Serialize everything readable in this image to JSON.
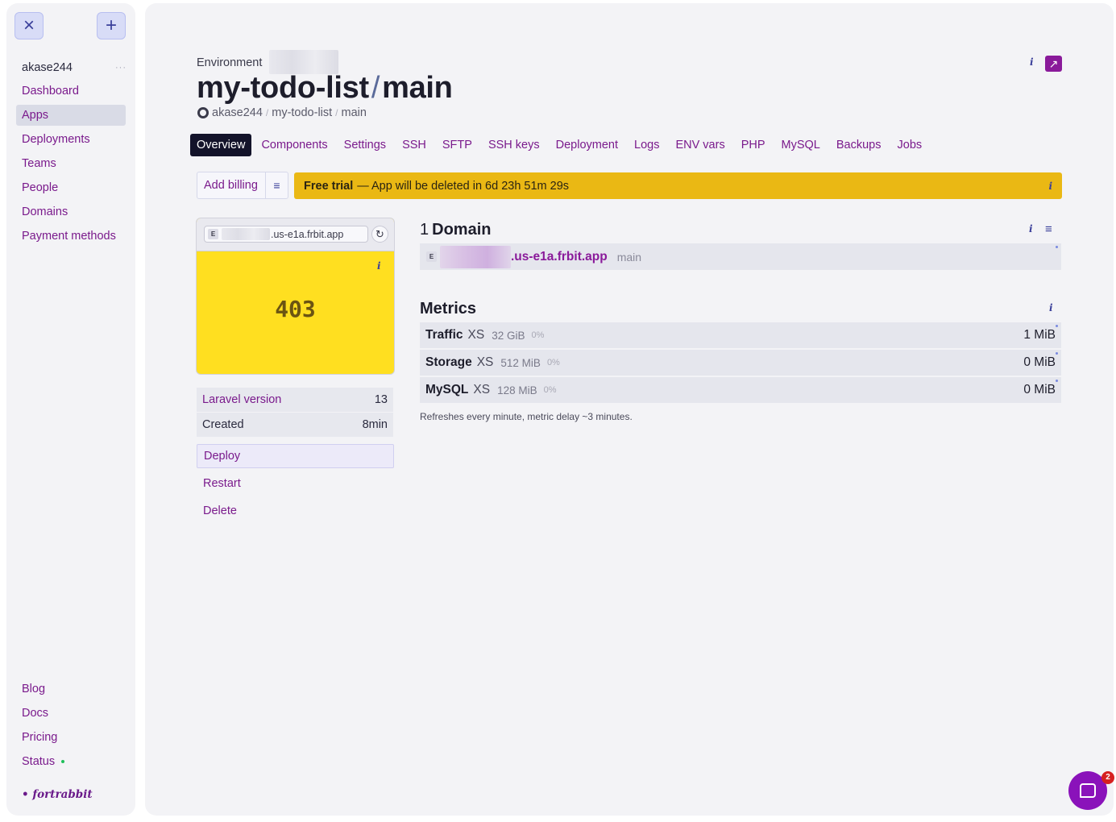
{
  "sidebar": {
    "close_icon": "×",
    "add_icon": "+",
    "user": "akase244",
    "user_more": "···",
    "items": [
      {
        "label": "Dashboard"
      },
      {
        "label": "Apps"
      },
      {
        "label": "Deployments"
      },
      {
        "label": "Teams"
      },
      {
        "label": "People"
      },
      {
        "label": "Domains"
      },
      {
        "label": "Payment methods"
      }
    ],
    "bottom_items": [
      {
        "label": "Blog"
      },
      {
        "label": "Docs"
      },
      {
        "label": "Pricing"
      },
      {
        "label": "Status"
      }
    ],
    "logo": "• fortrabbit"
  },
  "header": {
    "env_label": "Environment",
    "title_app": "my-todo-list",
    "title_sep": "/",
    "title_env": "main",
    "crumb_owner": "akase244",
    "crumb_sep": "/",
    "crumb_repo": "my-todo-list",
    "crumb_branch": "main",
    "info": "i",
    "external_icon": "↗"
  },
  "tabs": [
    {
      "label": "Overview"
    },
    {
      "label": "Components"
    },
    {
      "label": "Settings"
    },
    {
      "label": "SSH"
    },
    {
      "label": "SFTP"
    },
    {
      "label": "SSH keys"
    },
    {
      "label": "Deployment"
    },
    {
      "label": "Logs"
    },
    {
      "label": "ENV vars"
    },
    {
      "label": "PHP"
    },
    {
      "label": "MySQL"
    },
    {
      "label": "Backups"
    },
    {
      "label": "Jobs"
    }
  ],
  "billing": {
    "label": "Add billing",
    "menu_icon": "≡"
  },
  "trial": {
    "strong": "Free trial",
    "text": "— App will be deleted in 6d 23h 51m 29s",
    "info": "i"
  },
  "preview": {
    "badge": "E",
    "url_suffix": ".us-e1a.frbit.app",
    "reload_icon": "↻",
    "info": "i",
    "status_code": "403"
  },
  "details": {
    "rows": [
      {
        "key": "Laravel version",
        "value": "13"
      },
      {
        "key": "Created",
        "value": "8min"
      }
    ],
    "actions": [
      {
        "label": "Deploy"
      },
      {
        "label": "Restart"
      },
      {
        "label": "Delete"
      }
    ]
  },
  "domain": {
    "count": "1",
    "title": "Domain",
    "info": "i",
    "menu_icon": "≡",
    "badge": "E",
    "host_suffix": ".us-e1a.frbit.app",
    "branch": "main"
  },
  "metrics": {
    "title": "Metrics",
    "info": "i",
    "rows": [
      {
        "name": "Traffic",
        "tier": "XS",
        "limit": "32 GiB",
        "pct": "0%",
        "value": "1 MiB"
      },
      {
        "name": "Storage",
        "tier": "XS",
        "limit": "512 MiB",
        "pct": "0%",
        "value": "0 MiB"
      },
      {
        "name": "MySQL",
        "tier": "XS",
        "limit": "128 MiB",
        "pct": "0%",
        "value": "0 MiB"
      }
    ],
    "note": "Refreshes every minute, metric delay ~3 minutes."
  },
  "chat": {
    "badge_count": "2"
  },
  "colors": {
    "accent": "#7a1a8c",
    "trial_bar": "#eab814",
    "preview_bg": "#ffdf20",
    "chat": "#8a12ba",
    "badge": "#d62020"
  }
}
